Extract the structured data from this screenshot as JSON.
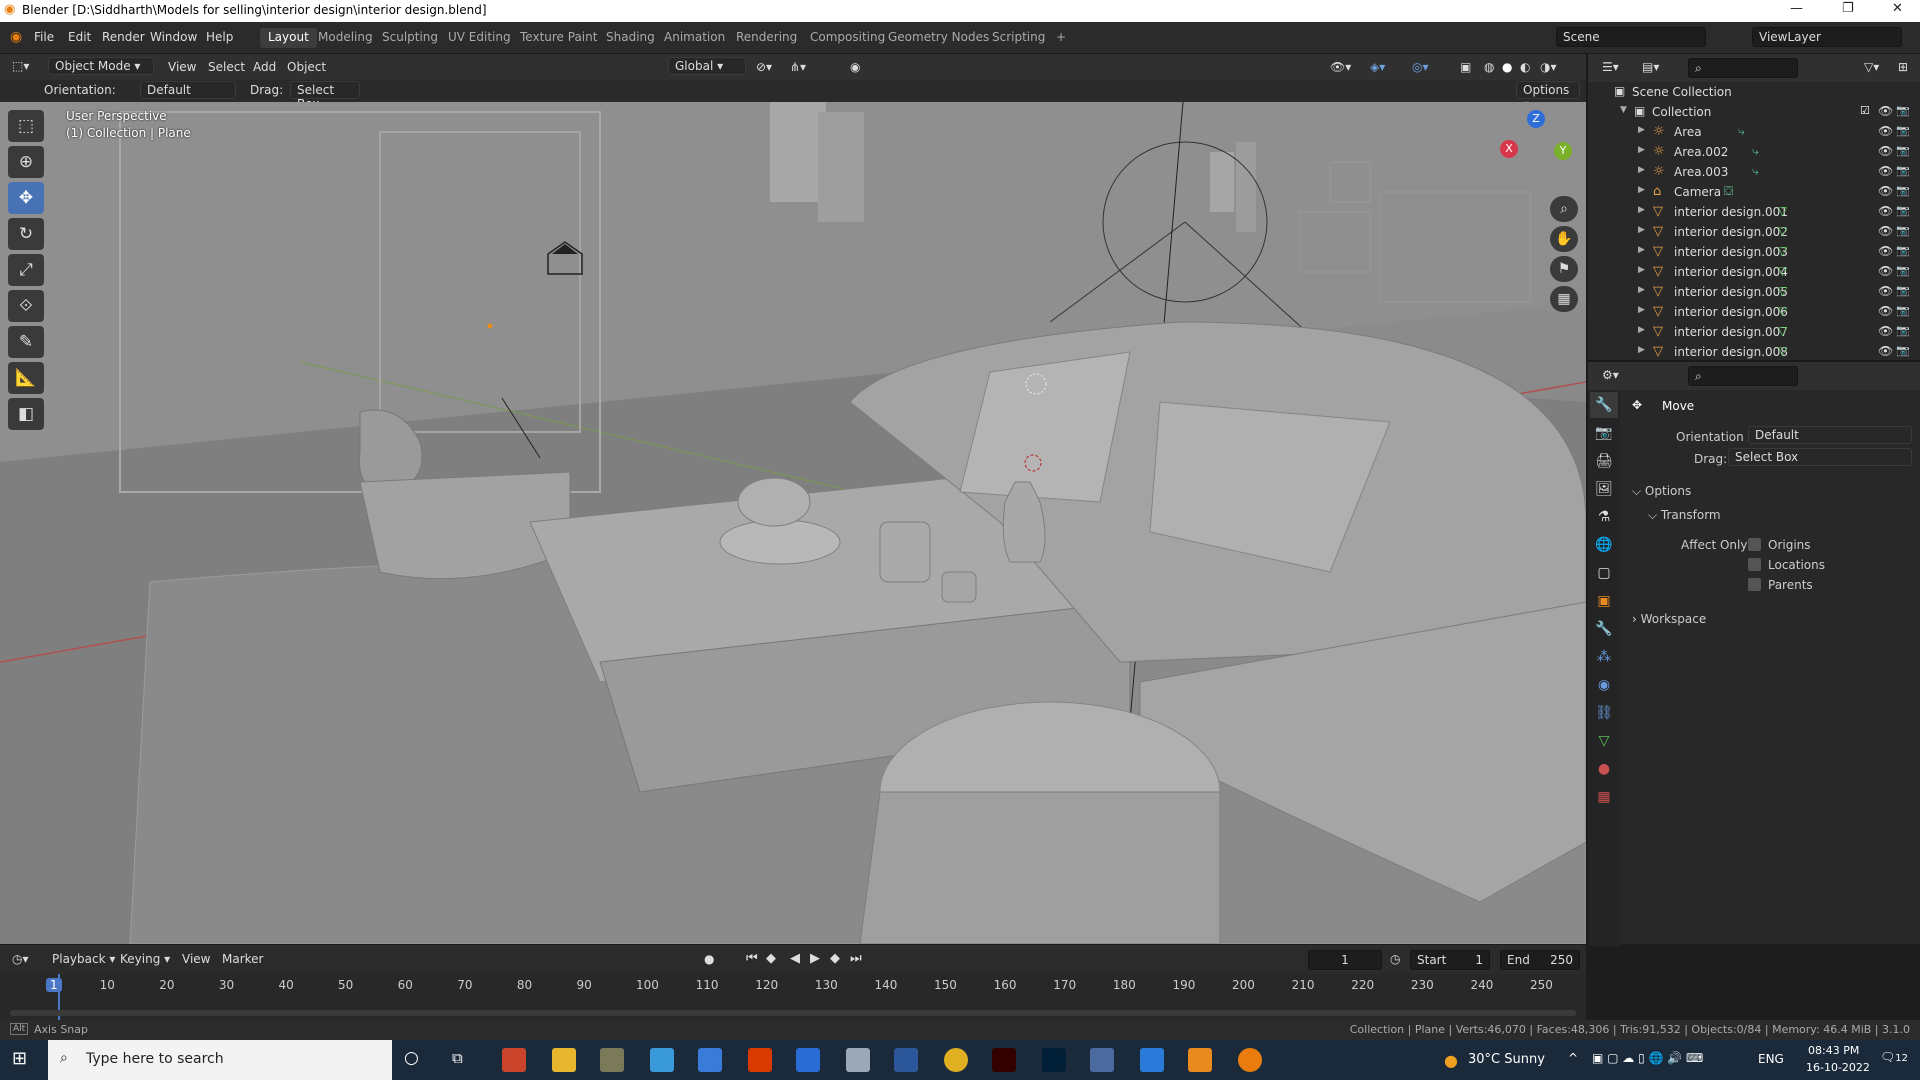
{
  "window": {
    "title": "Blender [D:\\Siddharth\\Models for selling\\interior design\\interior design.blend]"
  },
  "menus": [
    "File",
    "Edit",
    "Render",
    "Window",
    "Help"
  ],
  "workspaces": [
    "Layout",
    "Modeling",
    "Sculpting",
    "UV Editing",
    "Texture Paint",
    "Shading",
    "Animation",
    "Rendering",
    "Compositing",
    "Geometry Nodes",
    "Scripting"
  ],
  "scene": "Scene",
  "view_layer": "ViewLayer",
  "header3d": {
    "mode": "Object Mode",
    "menus": [
      "View",
      "Select",
      "Add",
      "Object"
    ],
    "transform": "Global"
  },
  "toolhdr": {
    "orientation_label": "Orientation:",
    "orientation": "Default",
    "drag_label": "Drag:",
    "drag": "Select Box",
    "options": "Options"
  },
  "viewport": {
    "perspective": "User Perspective",
    "collection": "(1) Collection | Plane",
    "gizmo": [
      "X",
      "Y",
      "Z"
    ]
  },
  "outliner": {
    "root": "Scene Collection",
    "collection": "Collection",
    "items": [
      "Area",
      "Area.002",
      "Area.003",
      "Camera",
      "interior design.001",
      "interior design.002",
      "interior design.003",
      "interior design.004",
      "interior design.005",
      "interior design.006",
      "interior design.007",
      "interior design.008"
    ]
  },
  "props": {
    "tool": "Move",
    "orientation_label": "Orientation",
    "orientation": "Default",
    "drag_label": "Drag:",
    "drag": "Select Box",
    "options": "Options",
    "transform": "Transform",
    "affect_only": "Affect Only",
    "origins": "Origins",
    "locations": "Locations",
    "parents": "Parents",
    "workspace": "Workspace"
  },
  "timeline": {
    "menus": [
      "Playback",
      "Keying",
      "View",
      "Marker"
    ],
    "current": "1",
    "start_label": "Start",
    "start": "1",
    "end_label": "End",
    "end": "250",
    "ticks": [
      "1",
      "10",
      "20",
      "30",
      "40",
      "50",
      "60",
      "70",
      "80",
      "90",
      "100",
      "110",
      "120",
      "130",
      "140",
      "150",
      "160",
      "170",
      "180",
      "190",
      "200",
      "210",
      "220",
      "230",
      "240",
      "250"
    ]
  },
  "status": {
    "left": "Axis Snap",
    "right": "Collection | Plane | Verts:46,070 | Faces:48,306 | Tris:91,532 | Objects:0/84 | Memory: 46.4 MiB | 3.1.0"
  },
  "taskbar": {
    "search": "Type here to search",
    "weather": "30°C  Sunny",
    "lang": "ENG",
    "time": "08:43 PM",
    "date": "16-10-2022",
    "notif": "12"
  }
}
